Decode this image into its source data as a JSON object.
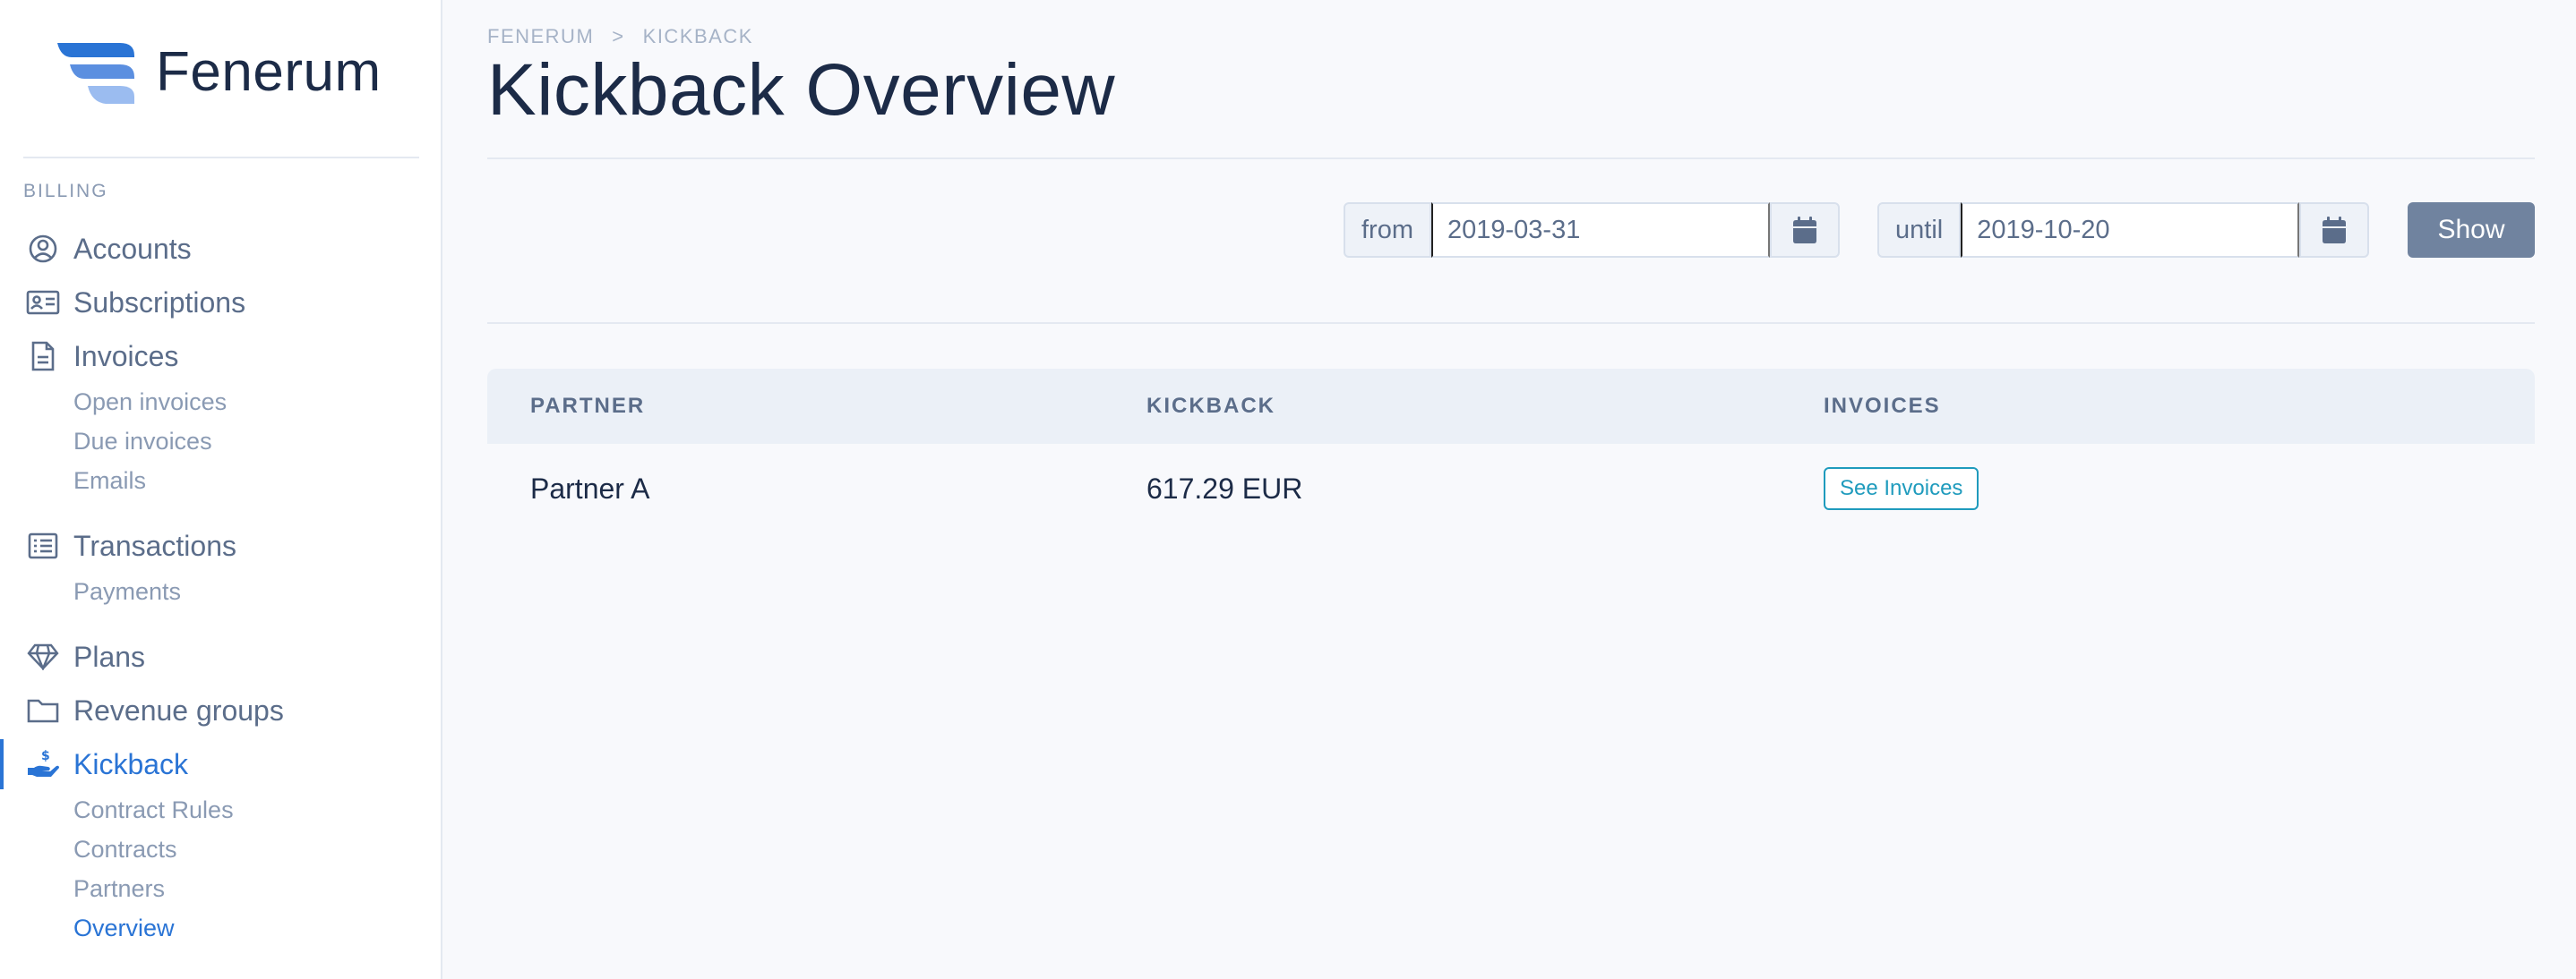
{
  "brand": {
    "name": "Fenerum"
  },
  "sidebar": {
    "section_label": "BILLING",
    "items": [
      {
        "label": "Accounts",
        "icon": "user-circle-icon"
      },
      {
        "label": "Subscriptions",
        "icon": "id-card-icon"
      },
      {
        "label": "Invoices",
        "icon": "document-icon",
        "children": [
          "Open invoices",
          "Due invoices",
          "Emails"
        ]
      },
      {
        "label": "Transactions",
        "icon": "list-icon",
        "children": [
          "Payments"
        ]
      },
      {
        "label": "Plans",
        "icon": "gem-icon"
      },
      {
        "label": "Revenue groups",
        "icon": "folder-icon"
      },
      {
        "label": "Kickback",
        "icon": "hand-holding-dollar-icon",
        "active": true,
        "children": [
          "Contract Rules",
          "Contracts",
          "Partners",
          "Overview"
        ],
        "active_child": "Overview"
      }
    ]
  },
  "breadcrumb": {
    "root": "FENERUM",
    "separator": ">",
    "current": "KICKBACK"
  },
  "page": {
    "title": "Kickback Overview"
  },
  "filters": {
    "from": {
      "label": "from",
      "value": "2019-03-31"
    },
    "until": {
      "label": "until",
      "value": "2019-10-20"
    },
    "show_label": "Show"
  },
  "table": {
    "columns": [
      "PARTNER",
      "KICKBACK",
      "INVOICES"
    ],
    "rows": [
      {
        "partner": "Partner A",
        "kickback": "617.29 EUR",
        "action_label": "See Invoices"
      }
    ]
  },
  "colors": {
    "accent": "#2a74d5",
    "muted": "#5b6d8a",
    "button": "#70839f",
    "link": "#1f9bbd"
  }
}
